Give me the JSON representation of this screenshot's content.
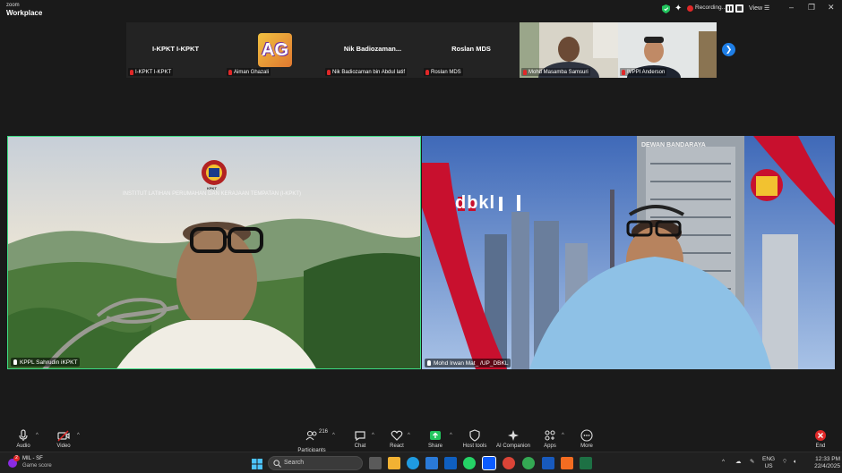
{
  "app": {
    "brand_line1": "zoom",
    "brand_line2": "Workplace"
  },
  "recording": {
    "label": "Recording...",
    "view_label": "View"
  },
  "strip": [
    {
      "display": "I-KPKT I-KPKT",
      "label": "I-KPKT I-KPKT"
    },
    {
      "display": "AG",
      "label": "Aiman Ghazali"
    },
    {
      "display": "Nik  Badiozaman...",
      "label": "Nik Badiozaman bin Abdul latif"
    },
    {
      "display": "Roslan MDS",
      "label": "Roslan MDS"
    },
    {
      "display": "",
      "label": "Mohd Masamba Samsuri"
    },
    {
      "display": "",
      "label": "IVPPI Anderson"
    }
  ],
  "main": {
    "left": {
      "name": "KPPL Sahrudin iKPKT",
      "bg_text": "INSTITUT LATIHAN PERUMAHAN DAN KERAJAAN TEMPATAN (I-KPKT)",
      "emblem_text": "KPKT"
    },
    "right": {
      "name": "Mohd Irwan Mat_ /UP_DBKL",
      "logo_text": "dbkl",
      "tower_text": "DEWAN BANDARAYA"
    }
  },
  "toolbar": {
    "audio": "Audio",
    "video": "Video",
    "participants": "Participants",
    "participant_count": "216",
    "chat": "Chat",
    "react": "React",
    "share": "Share",
    "host_tools": "Host tools",
    "ai_companion": "AI Companion",
    "apps": "Apps",
    "more": "More",
    "end": "End"
  },
  "taskbar": {
    "weather_line1": "MIL - SF",
    "weather_line2": "Game score",
    "weather_badge": "2",
    "search_placeholder": "Search",
    "lang_line1": "ENG",
    "lang_line2": "US",
    "time": "12:33 PM",
    "date": "22/4/2025"
  },
  "colors": {
    "accent_blue": "#1e7ee6",
    "active_speaker_border": "#3ddc84",
    "recording_red": "#e02828",
    "end_red": "#e02828",
    "share_green": "#22c55e"
  }
}
